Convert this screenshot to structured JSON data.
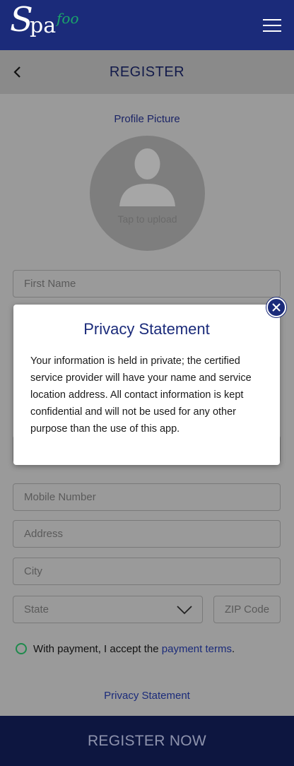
{
  "app": {
    "logo_s": "S",
    "logo_pa": "pa",
    "logo_foo": "foo"
  },
  "header": {
    "title": "REGISTER"
  },
  "form": {
    "profile_label": "Profile Picture",
    "tap_to_upload": "Tap to upload",
    "first_name_placeholder": "First Name",
    "mobile_placeholder": "Mobile Number",
    "address_placeholder": "Address",
    "city_placeholder": "City",
    "state_placeholder": "State",
    "zip_placeholder": "ZIP Code",
    "terms_prefix": "With payment, I accept the ",
    "terms_link": "payment terms",
    "terms_suffix": ".",
    "privacy_link": "Privacy Statement"
  },
  "footer": {
    "register_label": "REGISTER NOW"
  },
  "modal": {
    "title": "Privacy Statement",
    "body": "Your information is held in private; the certified service provider will have your name and service location address. All contact information is kept confidential and will not be used for any other purpose than the use of this app."
  },
  "colors": {
    "primary": "#1b2b7a",
    "accent_green": "#1aa56a",
    "overlay_gray": "#9a9a9a"
  },
  "icons": [
    "menu-icon",
    "back-icon",
    "avatar-icon",
    "chevron-down-icon",
    "close-icon"
  ]
}
